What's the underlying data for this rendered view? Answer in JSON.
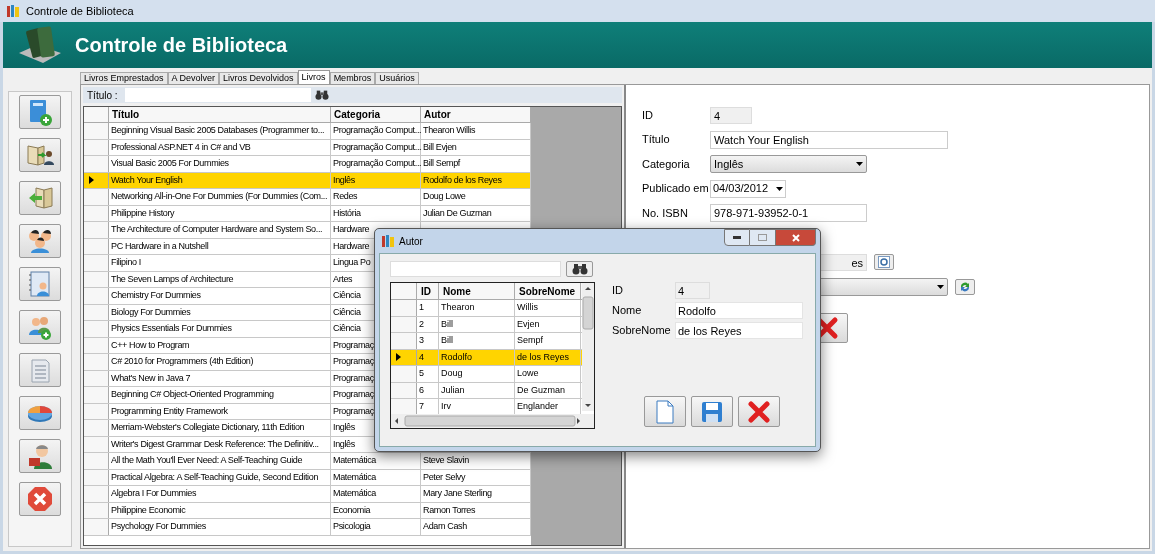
{
  "window": {
    "title": "Controle de Biblioteca"
  },
  "header": {
    "title": "Controle de Biblioteca"
  },
  "sidebar": {
    "buttons": [
      {
        "kind": "add-book"
      },
      {
        "kind": "lend"
      },
      {
        "kind": "return"
      },
      {
        "kind": "members"
      },
      {
        "kind": "contacts"
      },
      {
        "kind": "add-user"
      },
      {
        "kind": "report"
      },
      {
        "kind": "chart"
      },
      {
        "kind": "reader"
      },
      {
        "kind": "exit"
      }
    ]
  },
  "tabs": [
    {
      "label": "Livros Emprestados",
      "selected": false
    },
    {
      "label": "A Devolver",
      "selected": false
    },
    {
      "label": "Livros Devolvidos",
      "selected": false
    },
    {
      "label": "Livros",
      "selected": true
    },
    {
      "label": "Membros",
      "selected": false
    },
    {
      "label": "Usuários",
      "selected": false
    }
  ],
  "search": {
    "label": "Título :"
  },
  "table": {
    "columns": [
      "Título",
      "Categoria",
      "Autor"
    ],
    "rows": [
      {
        "cells": [
          "Beginning Visual Basic 2005 Databases (Programmer to...",
          "Programação Comput...",
          "Thearon Willis"
        ],
        "selected": false
      },
      {
        "cells": [
          "Professional ASP.NET 4 in C# and VB",
          "Programação Comput...",
          "Bill Evjen"
        ],
        "selected": false
      },
      {
        "cells": [
          "Visual Basic 2005 For Dummies",
          "Programação Comput...",
          "Bill Sempf"
        ],
        "selected": false
      },
      {
        "cells": [
          "Watch Your English",
          "Inglês",
          "Rodolfo de los Reyes"
        ],
        "selected": true
      },
      {
        "cells": [
          "Networking All-in-One For Dummies (For Dummies (Com...",
          "Redes",
          "Doug Lowe"
        ],
        "selected": false
      },
      {
        "cells": [
          "Philippine History",
          "História",
          "Julian De Guzman"
        ],
        "selected": false
      },
      {
        "cells": [
          "The Architecture of Computer Hardware and System So...",
          "Hardware",
          ""
        ],
        "selected": false
      },
      {
        "cells": [
          "PC Hardware in a Nutshell",
          "Hardware",
          ""
        ],
        "selected": false
      },
      {
        "cells": [
          "Filipino I",
          "Lingua Po",
          ""
        ],
        "selected": false
      },
      {
        "cells": [
          "The Seven Lamps of Architecture",
          "Artes",
          ""
        ],
        "selected": false
      },
      {
        "cells": [
          "Chemistry For Dummies",
          "Ciência",
          ""
        ],
        "selected": false
      },
      {
        "cells": [
          "Biology For Dummies",
          "Ciência",
          ""
        ],
        "selected": false
      },
      {
        "cells": [
          "Physics Essentials For Dummies",
          "Ciência",
          ""
        ],
        "selected": false
      },
      {
        "cells": [
          "C++ How to Program",
          "Programaç",
          ""
        ],
        "selected": false
      },
      {
        "cells": [
          "C# 2010 for Programmers (4th Edition)",
          "Programaç",
          ""
        ],
        "selected": false
      },
      {
        "cells": [
          "What's New in Java 7",
          "Programaç",
          ""
        ],
        "selected": false
      },
      {
        "cells": [
          "Beginning C# Object-Oriented Programming",
          "Programaç",
          ""
        ],
        "selected": false
      },
      {
        "cells": [
          "Programming Entity Framework",
          "Programaç",
          ""
        ],
        "selected": false
      },
      {
        "cells": [
          "Merriam-Webster's Collegiate Dictionary, 11th Edition",
          "Inglês",
          ""
        ],
        "selected": false
      },
      {
        "cells": [
          "Writer's Digest Grammar Desk Reference: The Definitiv...",
          "Inglês",
          ""
        ],
        "selected": false
      },
      {
        "cells": [
          "All the Math You'll Ever Need: A Self-Teaching Guide",
          "Matemática",
          "Steve Slavin"
        ],
        "selected": false
      },
      {
        "cells": [
          "Practical Algebra: A Self-Teaching Guide, Second Edition",
          "Matemática",
          "Peter Selvy"
        ],
        "selected": false
      },
      {
        "cells": [
          "Algebra I For Dummies",
          "Matemática",
          "Mary Jane Sterling"
        ],
        "selected": false
      },
      {
        "cells": [
          "Philippine Economic",
          "Economia",
          "Ramon Torres"
        ],
        "selected": false
      },
      {
        "cells": [
          "Psychology For Dummies",
          "Psicologia",
          "Adam Cash"
        ],
        "selected": false
      }
    ]
  },
  "form": {
    "fields": [
      {
        "kind": "readonly",
        "label": "ID",
        "value": "4"
      },
      {
        "kind": "text",
        "label": "Título",
        "value": "Watch Your English"
      },
      {
        "kind": "combo",
        "label": "Categoria",
        "value": "Inglês"
      },
      {
        "kind": "date",
        "label": "Publicado em",
        "value": "04/03/2012"
      },
      {
        "kind": "text",
        "label": "No. ISBN",
        "value": "978-971-93952-0-1"
      },
      {
        "kind": "lookup",
        "value": "es"
      },
      {
        "kind": "combo-button"
      }
    ],
    "buttons": [
      {
        "kind": "delete"
      }
    ]
  },
  "dialog": {
    "title": "Autor",
    "table": {
      "columns": [
        "ID",
        "Nome",
        "SobreNome"
      ],
      "rows": [
        {
          "cells": [
            "1",
            "Thearon",
            "Willis"
          ],
          "selected": false
        },
        {
          "cells": [
            "2",
            "Bill",
            "Evjen"
          ],
          "selected": false
        },
        {
          "cells": [
            "3",
            "Bill",
            "Sempf"
          ],
          "selected": false
        },
        {
          "cells": [
            "4",
            "Rodolfo",
            "de los Reyes"
          ],
          "selected": true
        },
        {
          "cells": [
            "5",
            "Doug",
            "Lowe"
          ],
          "selected": false
        },
        {
          "cells": [
            "6",
            "Julian",
            "De Guzman"
          ],
          "selected": false
        },
        {
          "cells": [
            "7",
            "Irv",
            "Englander"
          ],
          "selected": false
        }
      ]
    },
    "fields": [
      {
        "kind": "readonly",
        "label": "ID",
        "value": "4"
      },
      {
        "kind": "text",
        "label": "Nome",
        "value": "Rodolfo"
      },
      {
        "kind": "text",
        "label": "SobreNome",
        "value": "de los Reyes"
      }
    ],
    "buttons": [
      {
        "kind": "new"
      },
      {
        "kind": "save"
      },
      {
        "kind": "delete"
      }
    ]
  }
}
